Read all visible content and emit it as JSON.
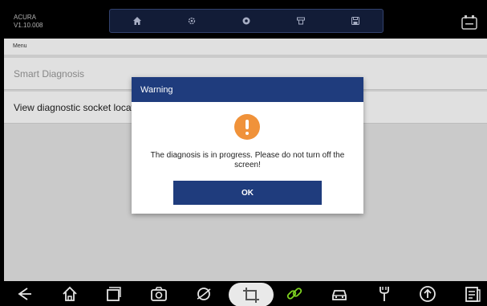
{
  "app": {
    "brand": "ACURA",
    "version": "V1.10.008"
  },
  "toolbar": {
    "buttons": [
      {
        "icon": "home-icon"
      },
      {
        "icon": "settings-icon"
      },
      {
        "icon": "record-icon"
      },
      {
        "icon": "print-icon"
      },
      {
        "icon": "save-icon"
      }
    ]
  },
  "menu": {
    "header": "Menu",
    "items": [
      {
        "label": "Smart Diagnosis"
      },
      {
        "label": "View diagnostic socket location"
      }
    ]
  },
  "dialog": {
    "title": "Warning",
    "icon": "warning-icon",
    "message": "The diagnosis is in progress. Please do not turn off the screen!",
    "ok_label": "OK"
  },
  "navbar": {
    "buttons": [
      "back-icon",
      "home-icon",
      "recent-apps-icon",
      "camera-icon",
      "browser-icon",
      "crop-icon",
      "link-icon",
      "car-icon",
      "tool-icon",
      "upload-icon",
      "document-icon"
    ]
  },
  "colors": {
    "accent": "#1f3c7d",
    "warning": "#f0923a",
    "link_green": "#7ed321"
  }
}
